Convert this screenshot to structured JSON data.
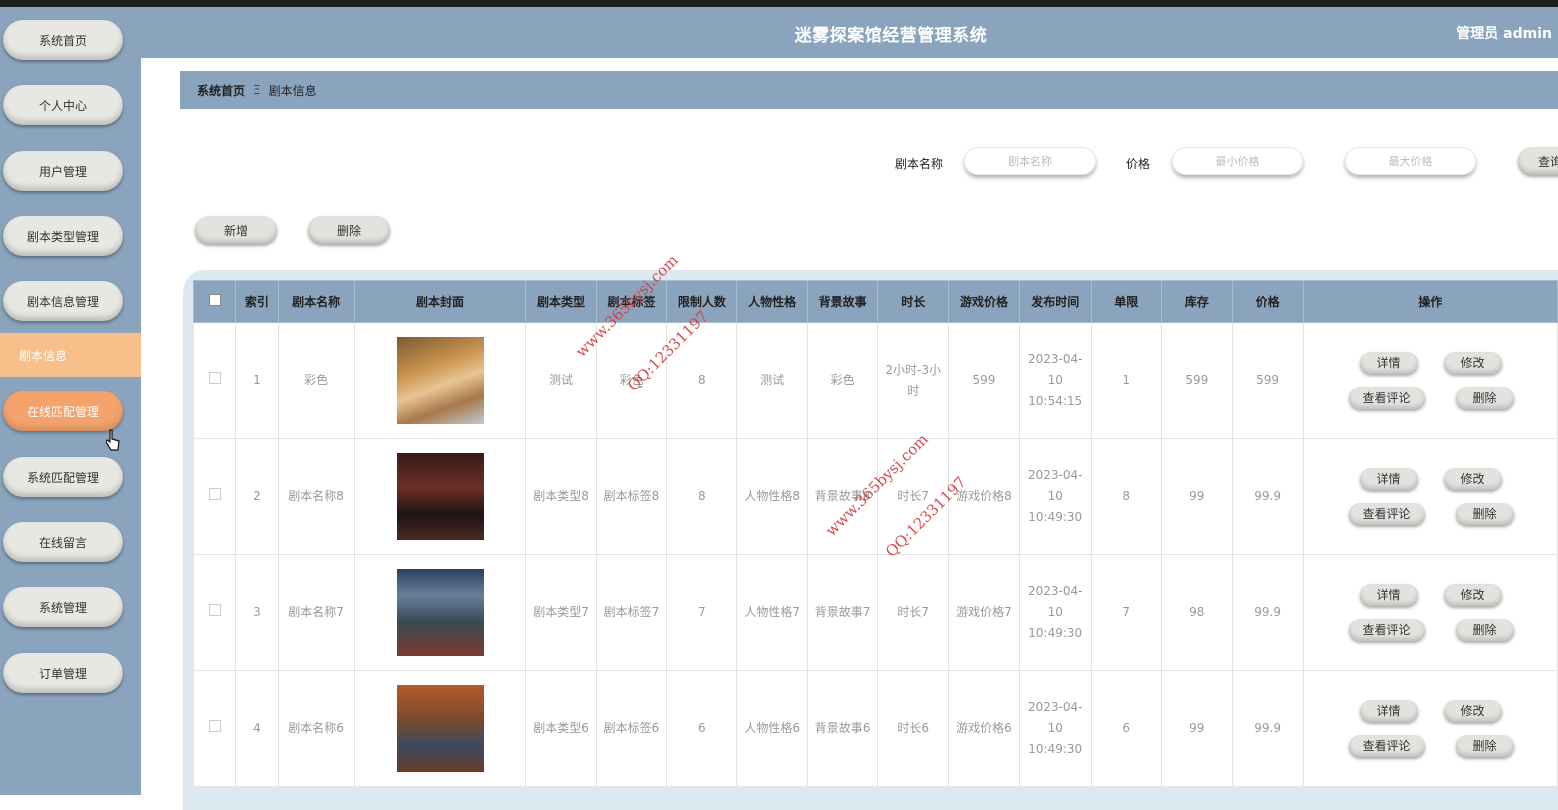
{
  "header": {
    "title": "迷雾探案馆经营管理系统",
    "user": "管理员 admin"
  },
  "sidebar": {
    "items": [
      {
        "label": "系统首页"
      },
      {
        "label": "个人中心"
      },
      {
        "label": "用户管理"
      },
      {
        "label": "剧本类型管理"
      },
      {
        "label": "剧本信息管理"
      },
      {
        "label": "在线匹配管理"
      },
      {
        "label": "系统匹配管理"
      },
      {
        "label": "在线留言"
      },
      {
        "label": "系统管理"
      },
      {
        "label": "订单管理"
      }
    ],
    "sub_item": "剧本信息"
  },
  "breadcrumb": {
    "home": "系统首页",
    "separator": "Ξ",
    "current": "剧本信息"
  },
  "search": {
    "name_label": "剧本名称",
    "name_placeholder": "剧本名称",
    "price_label": "价格",
    "min_placeholder": "最小价格",
    "max_placeholder": "最大价格",
    "query_button": "查询"
  },
  "toolbar": {
    "add_label": "新增",
    "delete_label": "删除"
  },
  "table": {
    "columns": [
      "索引",
      "剧本名称",
      "剧本封面",
      "剧本类型",
      "剧本标签",
      "限制人数",
      "人物性格",
      "背景故事",
      "时长",
      "游戏价格",
      "发布时间",
      "单限",
      "库存",
      "价格",
      "操作"
    ],
    "rows": [
      {
        "index": "1",
        "name": "彩色",
        "type": "测试",
        "tag": "彩色",
        "limit": "8",
        "character": "测试",
        "story": "彩色",
        "duration": "2小时-3小时",
        "game_price": "599",
        "time": "2023-04-10 10:54:15",
        "single": "1",
        "stock": "599",
        "price": "599"
      },
      {
        "index": "2",
        "name": "剧本名称8",
        "type": "剧本类型8",
        "tag": "剧本标签8",
        "limit": "8",
        "character": "人物性格8",
        "story": "背景故事8",
        "duration": "时长7",
        "game_price": "游戏价格8",
        "time": "2023-04-10 10:49:30",
        "single": "8",
        "stock": "99",
        "price": "99.9"
      },
      {
        "index": "3",
        "name": "剧本名称7",
        "type": "剧本类型7",
        "tag": "剧本标签7",
        "limit": "7",
        "character": "人物性格7",
        "story": "背景故事7",
        "duration": "时长7",
        "game_price": "游戏价格7",
        "time": "2023-04-10 10:49:30",
        "single": "7",
        "stock": "98",
        "price": "99.9"
      },
      {
        "index": "4",
        "name": "剧本名称6",
        "type": "剧本类型6",
        "tag": "剧本标签6",
        "limit": "6",
        "character": "人物性格6",
        "story": "背景故事6",
        "duration": "时长6",
        "game_price": "游戏价格6",
        "time": "2023-04-10 10:49:30",
        "single": "6",
        "stock": "99",
        "price": "99.9"
      }
    ],
    "actions": {
      "detail": "详情",
      "edit": "修改",
      "comments": "查看评论",
      "delete": "删除"
    }
  },
  "watermarks": {
    "site": "www.365bysj.com",
    "qq": "QQ:12331197"
  },
  "colors": {
    "accent": "#8aa4be",
    "active": "#f3a26b",
    "sub_active": "#f7c08a",
    "watermark": "#d23a3a"
  }
}
